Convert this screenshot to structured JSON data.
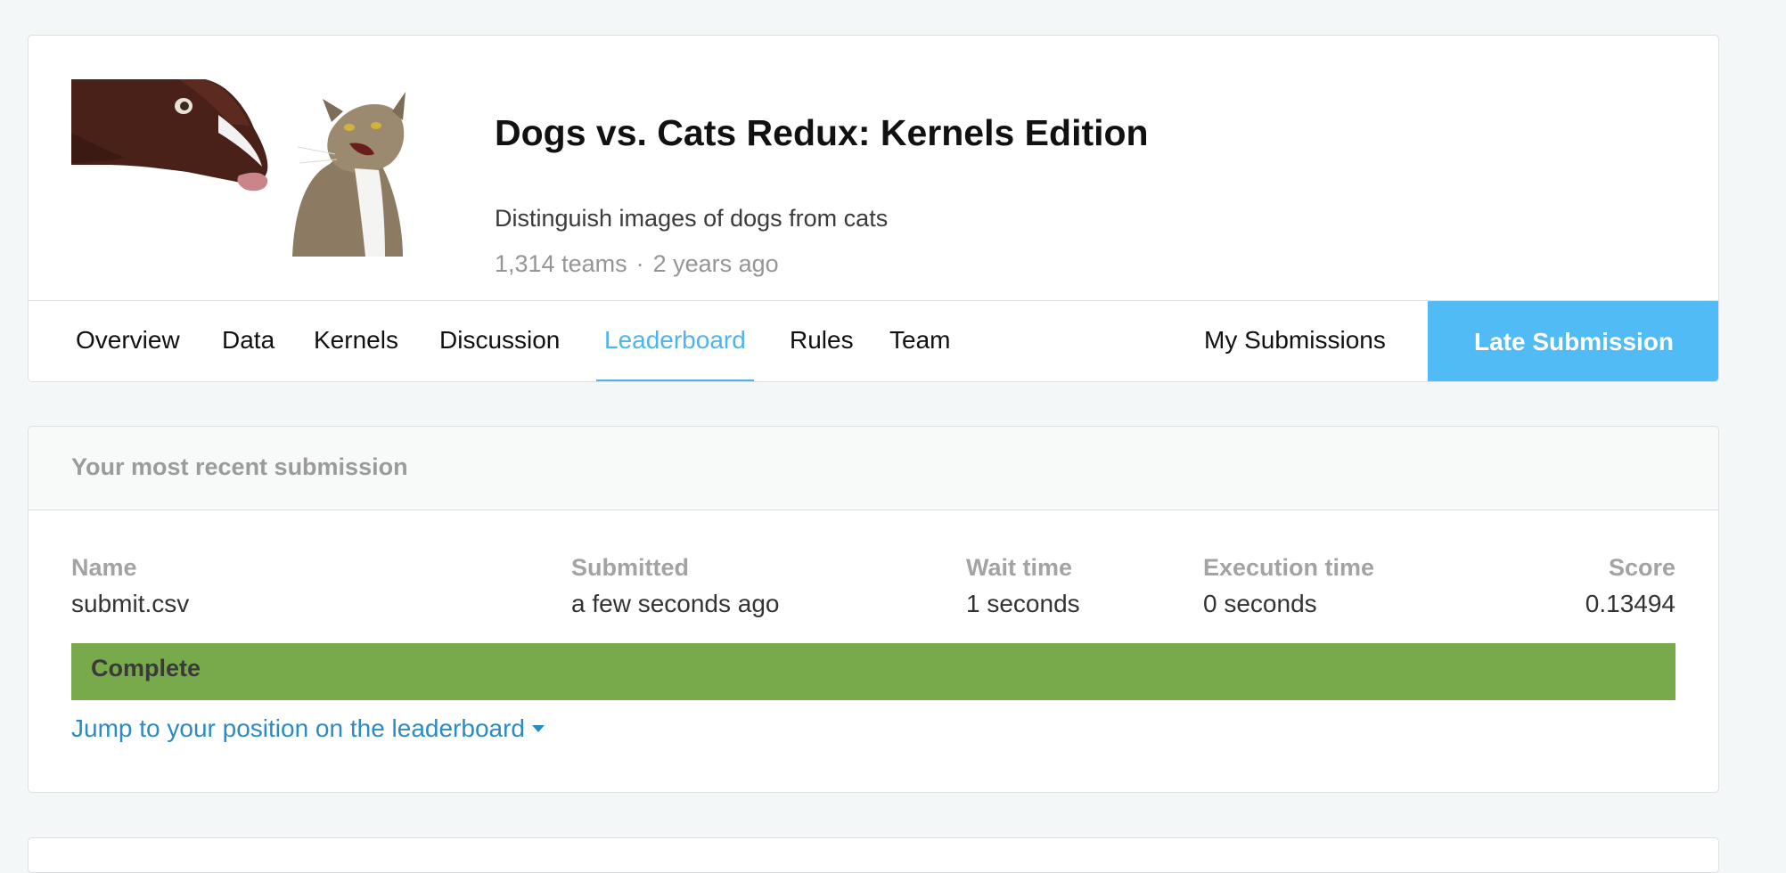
{
  "competition": {
    "title": "Dogs vs. Cats Redux: Kernels Edition",
    "subtitle": "Distinguish images of dogs from cats",
    "teams": "1,314 teams",
    "separator": "·",
    "age": "2 years ago",
    "image_icon": "dog-and-cat-photo"
  },
  "tabs": [
    {
      "label": "Overview"
    },
    {
      "label": "Data"
    },
    {
      "label": "Kernels"
    },
    {
      "label": "Discussion"
    },
    {
      "label": "Leaderboard",
      "active": true
    },
    {
      "label": "Rules"
    },
    {
      "label": "Team"
    }
  ],
  "actions": {
    "my_submissions": "My Submissions",
    "late_submission": "Late Submission"
  },
  "submission": {
    "heading": "Your most recent submission",
    "columns": {
      "name": {
        "label": "Name",
        "value": "submit.csv"
      },
      "submitted": {
        "label": "Submitted",
        "value": "a few seconds ago"
      },
      "wait_time": {
        "label": "Wait time",
        "value": "1 seconds"
      },
      "execution_time": {
        "label": "Execution time",
        "value": "0 seconds"
      },
      "score": {
        "label": "Score",
        "value": "0.13494"
      }
    },
    "status": "Complete",
    "jump_link": "Jump to your position on the leaderboard"
  },
  "colors": {
    "accent": "#4fb4ec",
    "late_submission_bg": "#51bbf6",
    "status_complete": "#78a94a",
    "link": "#2b8bc4"
  }
}
